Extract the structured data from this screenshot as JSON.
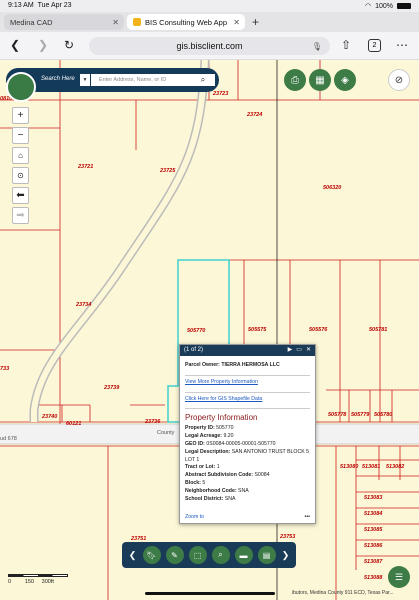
{
  "status": {
    "time": "9:13 AM",
    "date": "Tue Apr 23",
    "battery": "100%"
  },
  "tabs": [
    {
      "label": "Medina CAD",
      "active": false
    },
    {
      "label": "BIS Consulting Web App",
      "active": true
    }
  ],
  "address": {
    "url": "gis.bisclient.com",
    "tab_count": "2"
  },
  "search": {
    "label": "Search Here",
    "placeholder": "Enter Address, Name, or ID"
  },
  "map": {
    "parcels": [
      "08100",
      "23723",
      "23724",
      "23721",
      "23725",
      "506320",
      "23734",
      "505770",
      "505575",
      "505576",
      "505781",
      "733",
      "23739",
      "23740",
      "60121",
      "23736",
      "505778",
      "505779",
      "505780",
      "513080",
      "513081",
      "513082",
      "513083",
      "513084",
      "513085",
      "513086",
      "513087",
      "513088",
      "23751",
      "23753"
    ],
    "road_labels": [
      "ud 678",
      "County"
    ],
    "scale_ticks": [
      "0",
      "150",
      "300ft"
    ],
    "attribution": "ibutors, Medina County 911 ECD, Texas Par..."
  },
  "popup": {
    "pager": "(1 of 2)",
    "owner_label": "Parcel Owner:",
    "owner": "TIERRA HERMOSA LLC",
    "link_more": "View More Property Information",
    "link_shapefile": "Click Here for GIS Shapefile Data",
    "heading": "Property Information",
    "rows": [
      {
        "k": "Property ID:",
        "v": "505770"
      },
      {
        "k": "Legal Acreage:",
        "v": "9.20"
      },
      {
        "k": "GEO ID:",
        "v": "0S0084-00005-00001-505770"
      },
      {
        "k": "Legal Description:",
        "v": "SAN ANTONIO TRUST BLOCK 5 LOT 1"
      },
      {
        "k": "Tract or Lot:",
        "v": "1"
      },
      {
        "k": "Abstract Subdivision Code:",
        "v": "S0084"
      },
      {
        "k": "Block:",
        "v": "5"
      },
      {
        "k": "Neighborhood Code:",
        "v": "SNA"
      },
      {
        "k": "School District:",
        "v": "SNA"
      }
    ],
    "zoom": "Zoom to",
    "more": "•••"
  },
  "colors": {
    "navy": "#1a3b57",
    "green": "#3d7b47",
    "parcel": "#cc1f1f",
    "highlight": "#3fd0d0"
  },
  "icons": [
    "back-icon",
    "forward-icon",
    "reload-icon",
    "mic-icon",
    "share-icon",
    "add-icon",
    "more-icon",
    "print-icon",
    "grid-icon",
    "layers-icon",
    "eye-slash-icon",
    "zoom-in-icon",
    "zoom-out-icon",
    "home-icon",
    "locate-icon",
    "back-arrow-icon",
    "forward-arrow-icon",
    "bookmark-icon",
    "draw-icon",
    "select-icon",
    "search-map-icon",
    "measure-icon",
    "print-map-icon",
    "list-icon"
  ]
}
